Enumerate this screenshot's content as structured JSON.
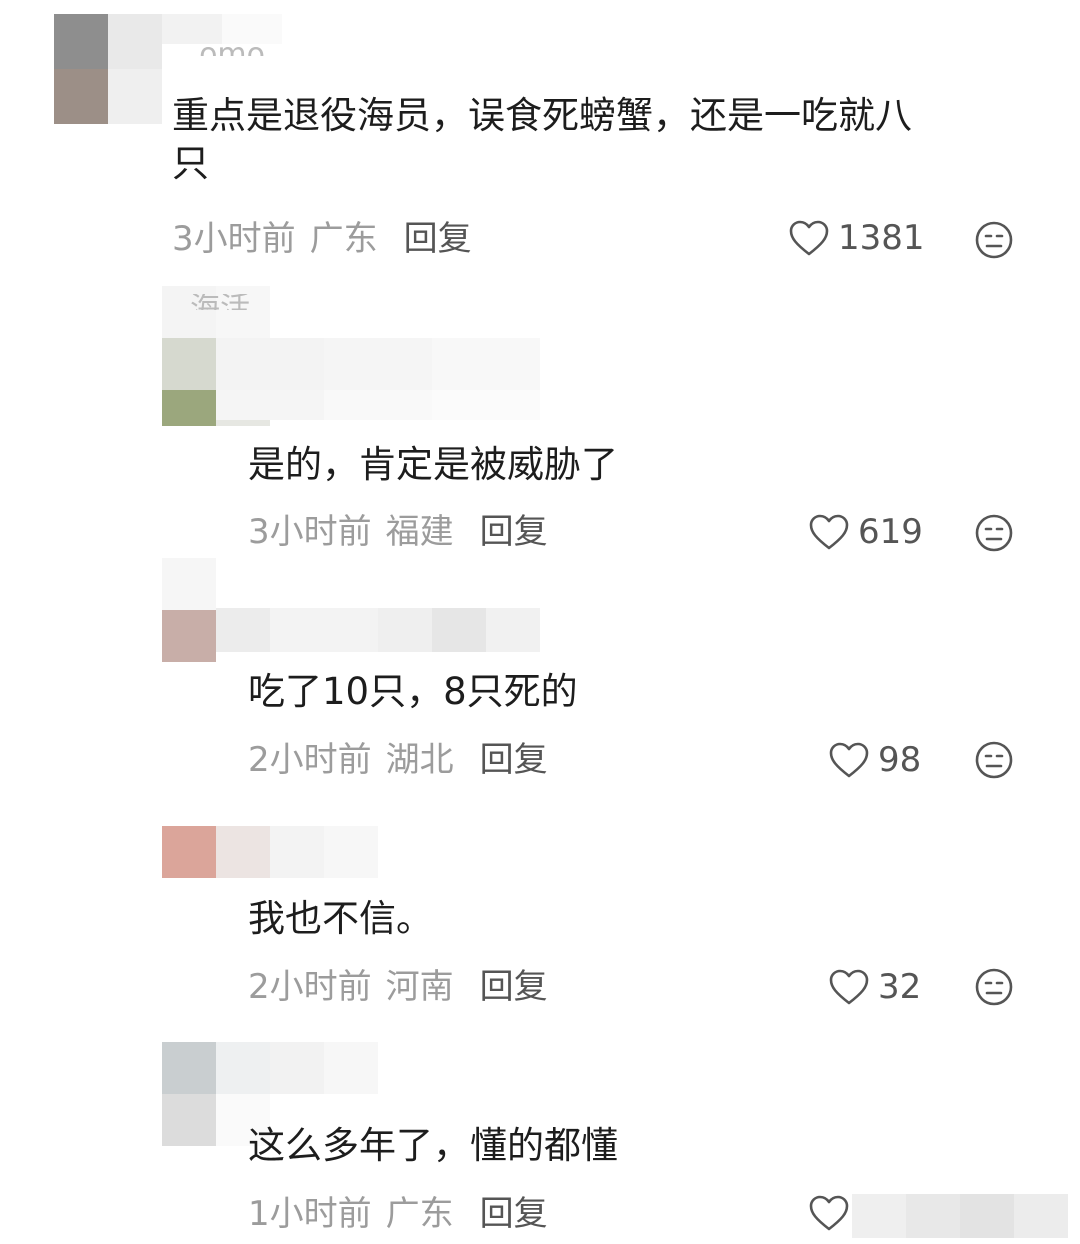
{
  "comments": [
    {
      "name_fragment": "..omo",
      "text": "重点是退役海员，误食死螃蟹，还是一吃就八\n只",
      "time": "3小时前",
      "location": "广东",
      "reply": "回复",
      "likes": "1381"
    },
    {
      "name_fragment": "海活",
      "text": "是的，肯定是被威胁了",
      "time": "3小时前",
      "location": "福建",
      "reply": "回复",
      "likes": "619"
    },
    {
      "text": "吃了10只，8只死的",
      "time": "2小时前",
      "location": "湖北",
      "reply": "回复",
      "likes": "98"
    },
    {
      "text": "我也不信。",
      "time": "2小时前",
      "location": "河南",
      "reply": "回复",
      "likes": "32"
    },
    {
      "text": "这么多年了，懂的都懂",
      "time": "1小时前",
      "location": "广东",
      "reply": "回复",
      "likes": ""
    }
  ],
  "icons": {
    "like": "heart-outline-icon",
    "dislike": "neutral-face-icon"
  },
  "colors": {
    "text": "#1d1d1d",
    "meta": "#9c9c9c",
    "reply": "#555555"
  }
}
